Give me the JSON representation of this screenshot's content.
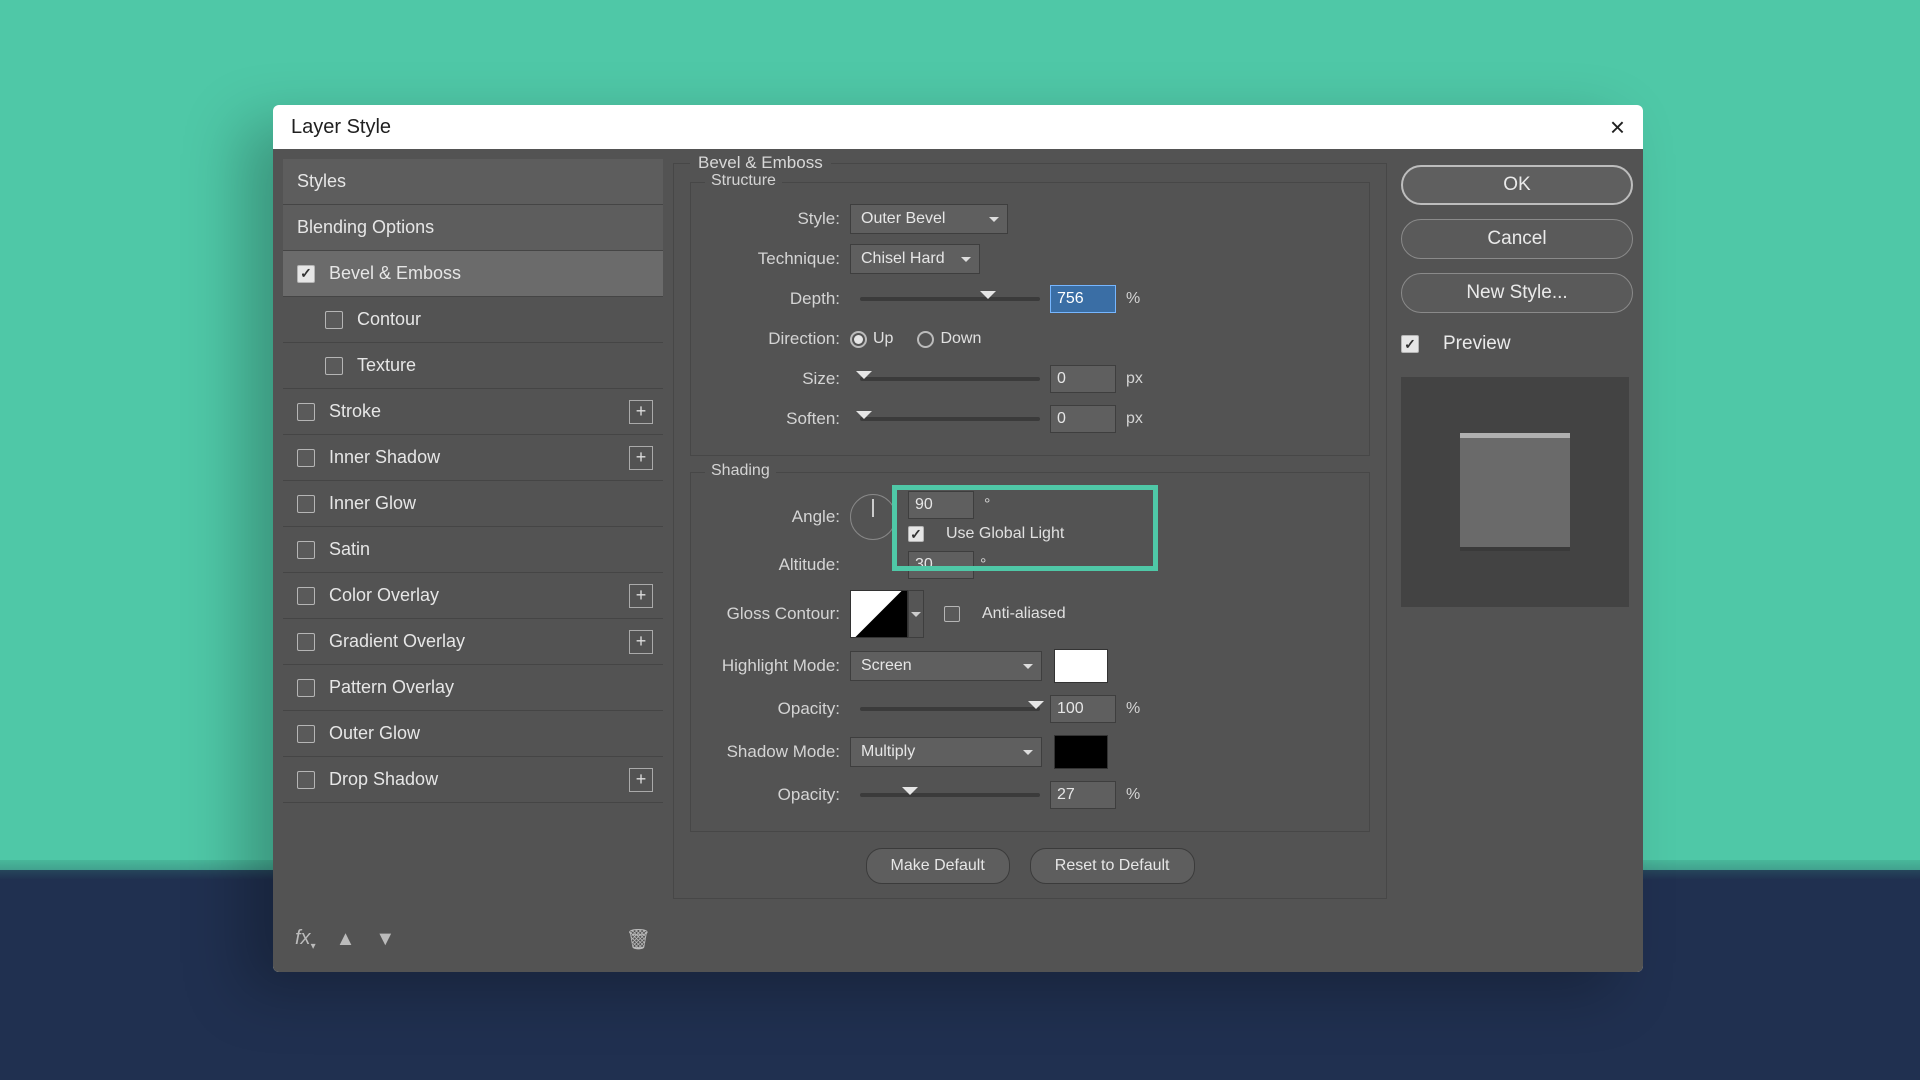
{
  "dialog": {
    "title": "Layer Style"
  },
  "sidebar": {
    "styles_header": "Styles",
    "blending_options": "Blending Options",
    "items": [
      {
        "label": "Bevel & Emboss",
        "checked": true,
        "selected": true
      },
      {
        "label": "Contour",
        "checked": false,
        "indent": true
      },
      {
        "label": "Texture",
        "checked": false,
        "indent": true
      },
      {
        "label": "Stroke",
        "checked": false,
        "plus": true
      },
      {
        "label": "Inner Shadow",
        "checked": false,
        "plus": true
      },
      {
        "label": "Inner Glow",
        "checked": false
      },
      {
        "label": "Satin",
        "checked": false
      },
      {
        "label": "Color Overlay",
        "checked": false,
        "plus": true
      },
      {
        "label": "Gradient Overlay",
        "checked": false,
        "plus": true
      },
      {
        "label": "Pattern Overlay",
        "checked": false
      },
      {
        "label": "Outer Glow",
        "checked": false
      },
      {
        "label": "Drop Shadow",
        "checked": false,
        "plus": true
      }
    ]
  },
  "panel": {
    "title": "Bevel & Emboss",
    "structure": {
      "title": "Structure",
      "style_label": "Style:",
      "style_value": "Outer Bevel",
      "technique_label": "Technique:",
      "technique_value": "Chisel Hard",
      "depth_label": "Depth:",
      "depth_value": "756",
      "depth_unit": "%",
      "direction_label": "Direction:",
      "direction_up": "Up",
      "direction_down": "Down",
      "size_label": "Size:",
      "size_value": "0",
      "size_unit": "px",
      "soften_label": "Soften:",
      "soften_value": "0",
      "soften_unit": "px"
    },
    "shading": {
      "title": "Shading",
      "angle_label": "Angle:",
      "angle_value": "90",
      "angle_unit": "°",
      "use_global_light": "Use Global Light",
      "altitude_label": "Altitude:",
      "altitude_value": "30",
      "altitude_unit": "°",
      "gloss_contour_label": "Gloss Contour:",
      "antialiased_label": "Anti-aliased",
      "highlight_mode_label": "Highlight Mode:",
      "highlight_mode_value": "Screen",
      "highlight_color": "#ffffff",
      "highlight_opacity_label": "Opacity:",
      "highlight_opacity_value": "100",
      "highlight_opacity_unit": "%",
      "shadow_mode_label": "Shadow Mode:",
      "shadow_mode_value": "Multiply",
      "shadow_color": "#000000",
      "shadow_opacity_label": "Opacity:",
      "shadow_opacity_value": "27",
      "shadow_opacity_unit": "%"
    },
    "make_default": "Make Default",
    "reset_default": "Reset to Default"
  },
  "right": {
    "ok": "OK",
    "cancel": "Cancel",
    "new_style": "New Style...",
    "preview": "Preview"
  }
}
